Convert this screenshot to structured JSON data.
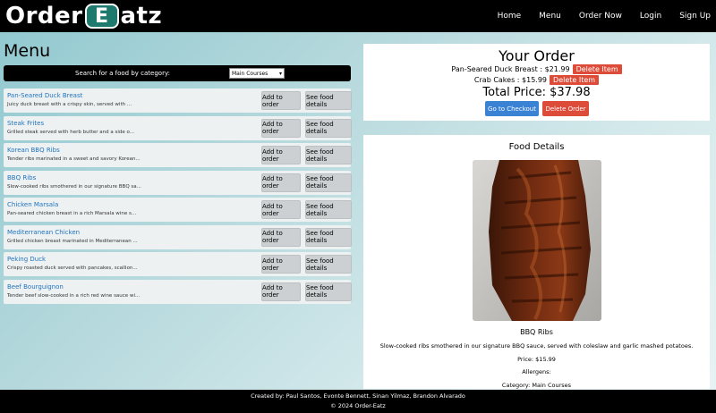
{
  "brand": {
    "logo_left": "Order",
    "logo_mark": "E",
    "logo_right": "atz"
  },
  "nav": {
    "links": [
      "Home",
      "Menu",
      "Order Now",
      "Login",
      "Sign Up"
    ]
  },
  "menu": {
    "title": "Menu",
    "search_label": "Search for a food by category:",
    "category_selected": "Main Courses",
    "add_label": "Add to order",
    "details_label": "See food details",
    "items": [
      {
        "name": "Pan-Seared Duck Breast",
        "desc": "Juicy duck breast with a crispy skin, served with ..."
      },
      {
        "name": "Steak Frites",
        "desc": "Grilled steak served with herb butter and a side o..."
      },
      {
        "name": "Korean BBQ Ribs",
        "desc": "Tender ribs marinated in a sweet and savory Korean..."
      },
      {
        "name": "BBQ Ribs",
        "desc": "Slow-cooked ribs smothered in our signature BBQ sa..."
      },
      {
        "name": "Chicken Marsala",
        "desc": "Pan-seared chicken breast in a rich Marsala wine s..."
      },
      {
        "name": "Mediterranean Chicken",
        "desc": "Grilled chicken breast marinated in Mediterranean ..."
      },
      {
        "name": "Peking Duck",
        "desc": "Crispy roasted duck served with pancakes, scallion..."
      },
      {
        "name": "Beef Bourguignon",
        "desc": "Tender beef slow-cooked in a rich red wine sauce wi..."
      }
    ]
  },
  "order": {
    "title": "Your Order",
    "lines": [
      {
        "text": "Pan-Seared Duck Breast : $21.99",
        "delete_label": "Delete Item"
      },
      {
        "text": "Crab Cakes : $15.99",
        "delete_label": "Delete Item"
      }
    ],
    "total": "Total Price: $37.98",
    "checkout_label": "Go to Checkout",
    "delete_order_label": "Delete Order"
  },
  "details": {
    "title": "Food Details",
    "name": "BBQ Ribs",
    "desc": "Slow-cooked ribs smothered in our signature BBQ sauce, served with coleslaw and garlic mashed potatoes.",
    "price": "Price: $15.99",
    "allergens": "Allergens:",
    "category": "Category: Main Courses"
  },
  "footer": {
    "credits": "Created by: Paul Santos, Evonte Bennett, Sinan Yilmaz, Brandon Alvarado",
    "copyright": "© 2024 Order-Eatz"
  },
  "colors": {
    "link_blue": "#1e73be",
    "delete_red": "#dd4b39",
    "checkout_blue": "#3a82d4"
  }
}
